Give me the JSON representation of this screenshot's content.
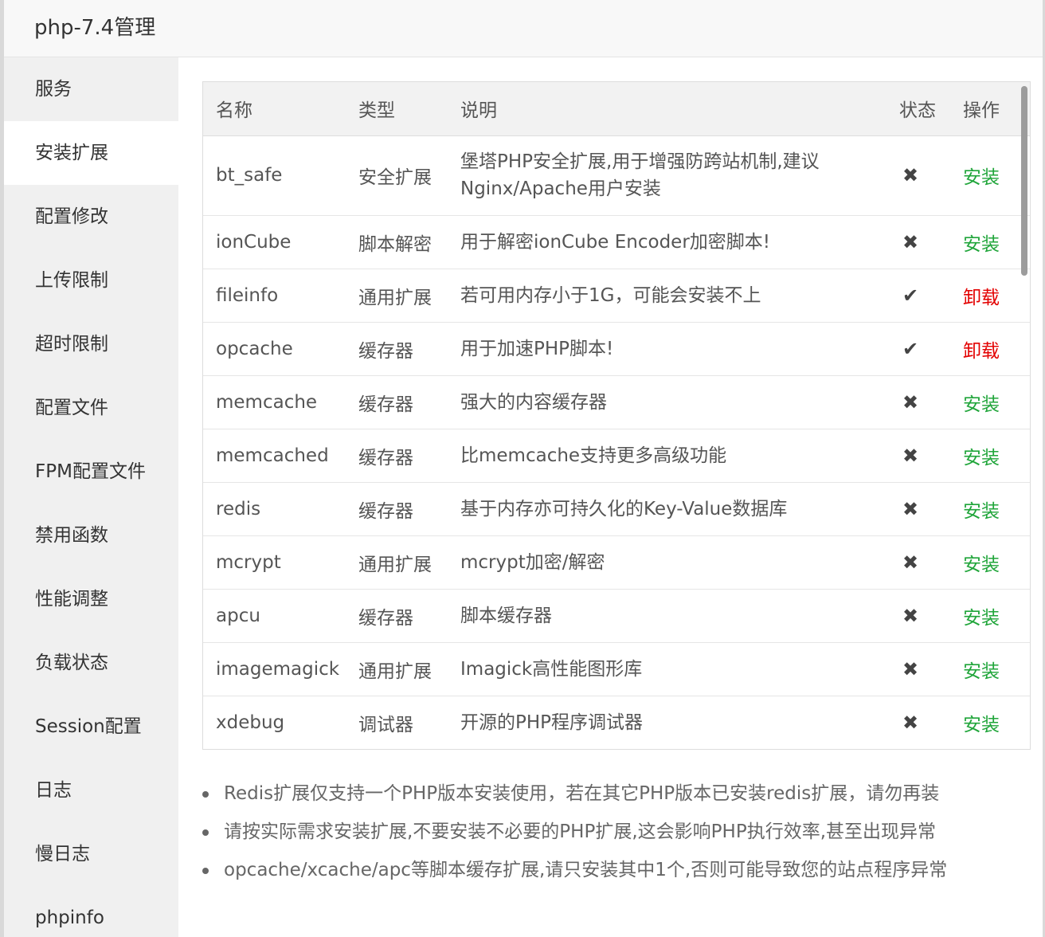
{
  "window": {
    "title": "php-7.4管理"
  },
  "colors": {
    "install": "#20a53a",
    "uninstall": "#e30000"
  },
  "sidebar": {
    "items": [
      {
        "label": "服务",
        "active": false
      },
      {
        "label": "安装扩展",
        "active": true
      },
      {
        "label": "配置修改",
        "active": false
      },
      {
        "label": "上传限制",
        "active": false
      },
      {
        "label": "超时限制",
        "active": false
      },
      {
        "label": "配置文件",
        "active": false
      },
      {
        "label": "FPM配置文件",
        "active": false
      },
      {
        "label": "禁用函数",
        "active": false
      },
      {
        "label": "性能调整",
        "active": false
      },
      {
        "label": "负载状态",
        "active": false
      },
      {
        "label": "Session配置",
        "active": false
      },
      {
        "label": "日志",
        "active": false
      },
      {
        "label": "慢日志",
        "active": false
      },
      {
        "label": "phpinfo",
        "active": false
      }
    ]
  },
  "table": {
    "headers": {
      "name": "名称",
      "type": "类型",
      "desc": "说明",
      "status": "状态",
      "op": "操作"
    },
    "rows": [
      {
        "name": "bt_safe",
        "type": "安全扩展",
        "desc": "堡塔PHP安全扩展,用于增强防跨站机制,建议Nginx/Apache用户安装",
        "installed": false,
        "status_icon": "✖",
        "op": "安装"
      },
      {
        "name": "ionCube",
        "type": "脚本解密",
        "desc": "用于解密ionCube Encoder加密脚本!",
        "installed": false,
        "status_icon": "✖",
        "op": "安装"
      },
      {
        "name": "fileinfo",
        "type": "通用扩展",
        "desc": "若可用内存小于1G，可能会安装不上",
        "installed": true,
        "status_icon": "✔",
        "op": "卸载"
      },
      {
        "name": "opcache",
        "type": "缓存器",
        "desc": "用于加速PHP脚本!",
        "installed": true,
        "status_icon": "✔",
        "op": "卸载"
      },
      {
        "name": "memcache",
        "type": "缓存器",
        "desc": "强大的内容缓存器",
        "installed": false,
        "status_icon": "✖",
        "op": "安装"
      },
      {
        "name": "memcached",
        "type": "缓存器",
        "desc": "比memcache支持更多高级功能",
        "installed": false,
        "status_icon": "✖",
        "op": "安装"
      },
      {
        "name": "redis",
        "type": "缓存器",
        "desc": "基于内存亦可持久化的Key-Value数据库",
        "installed": false,
        "status_icon": "✖",
        "op": "安装"
      },
      {
        "name": "mcrypt",
        "type": "通用扩展",
        "desc": "mcrypt加密/解密",
        "installed": false,
        "status_icon": "✖",
        "op": "安装"
      },
      {
        "name": "apcu",
        "type": "缓存器",
        "desc": "脚本缓存器",
        "installed": false,
        "status_icon": "✖",
        "op": "安装"
      },
      {
        "name": "imagemagick",
        "type": "通用扩展",
        "desc": "Imagick高性能图形库",
        "installed": false,
        "status_icon": "✖",
        "op": "安装"
      },
      {
        "name": "xdebug",
        "type": "调试器",
        "desc": "开源的PHP程序调试器",
        "installed": false,
        "status_icon": "✖",
        "op": "安装"
      }
    ]
  },
  "notes": [
    "Redis扩展仅支持一个PHP版本安装使用，若在其它PHP版本已安装redis扩展，请勿再装",
    "请按实际需求安装扩展,不要安装不必要的PHP扩展,这会影响PHP执行效率,甚至出现异常",
    "opcache/xcache/apc等脚本缓存扩展,请只安装其中1个,否则可能导致您的站点程序异常"
  ]
}
